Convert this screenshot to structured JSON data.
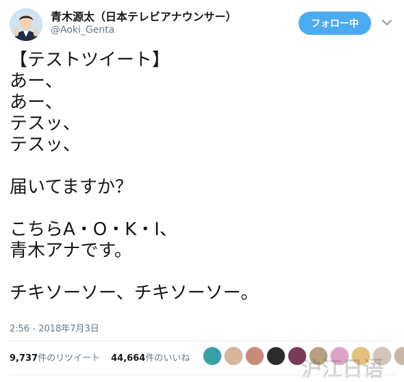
{
  "user": {
    "display_name": "青木源太（日本テレビアナウンサー）",
    "handle": "@Aoki_Genta"
  },
  "header": {
    "follow_label": "フォロー中",
    "follow_color": "#4aabf0"
  },
  "tweet": {
    "lines": [
      "【テストツイート】",
      "あー、",
      "あー、",
      "テスッ、",
      "テスッ、",
      "",
      "届いてますか？",
      "",
      "こちらA・O・K・I、",
      "青木アナです。",
      "",
      "チキソーソー、チキソーソー。"
    ],
    "timestamp": "2:56 - 2018年7月3日"
  },
  "stats": {
    "retweets_count": "9,737",
    "retweets_label": "件のリツイート",
    "likes_count": "44,664",
    "likes_label": "件のいいね"
  },
  "likers": [
    {
      "color": "#3aa0a8"
    },
    {
      "color": "#d8b49a"
    },
    {
      "color": "#c98a7a"
    },
    {
      "color": "#2b2b2b"
    },
    {
      "color": "#7a3a5a"
    },
    {
      "color": "#b7a07d"
    },
    {
      "color": "#e0a3c8"
    },
    {
      "color": "#e6c07a"
    },
    {
      "color": "#d3c4b8"
    },
    {
      "color": "#c8b6a6"
    }
  ],
  "watermark": "沪江日语"
}
